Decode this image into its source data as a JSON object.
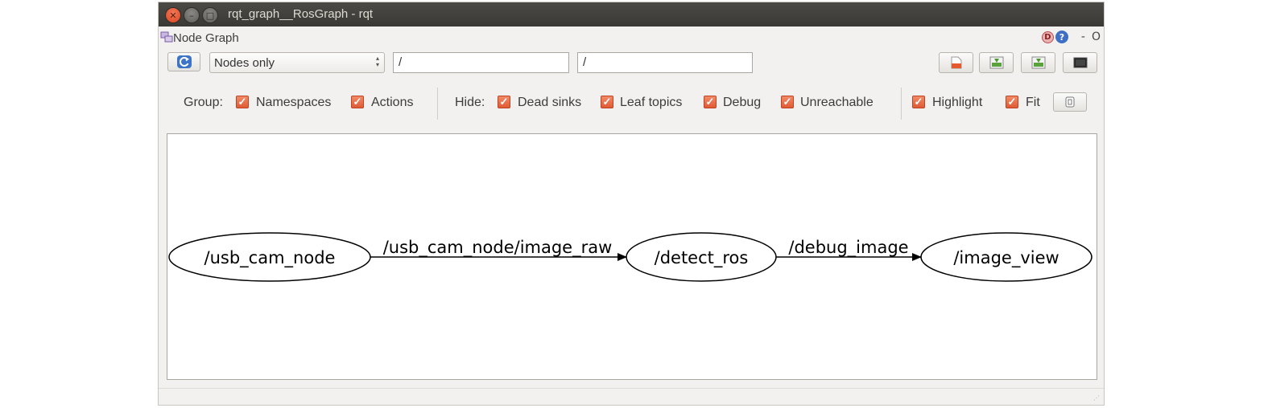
{
  "window": {
    "title": "rqt_graph__RosGraph - rqt"
  },
  "panel": {
    "title": "Node Graph",
    "d_badge": "D",
    "help_badge": "?",
    "minimize_label": "-",
    "close_label": "O"
  },
  "toolbar": {
    "mode_select": "Nodes only",
    "filter_include": "/",
    "filter_exclude": "/"
  },
  "options": {
    "group_label": "Group:",
    "namespaces_label": "Namespaces",
    "actions_label": "Actions",
    "hide_label": "Hide:",
    "dead_sinks_label": "Dead sinks",
    "leaf_topics_label": "Leaf topics",
    "debug_label": "Debug",
    "unreachable_label": "Unreachable",
    "highlight_label": "Highlight",
    "fit_label": "Fit"
  },
  "graph": {
    "nodes": [
      "/usb_cam_node",
      "/detect_ros",
      "/image_view"
    ],
    "edges": [
      {
        "from": "/usb_cam_node",
        "to": "/detect_ros",
        "label": "/usb_cam_node/image_raw"
      },
      {
        "from": "/detect_ros",
        "to": "/image_view",
        "label": "/debug_image"
      }
    ]
  },
  "colors": {
    "checkbox": "#de5b35",
    "titlebar": "#3c3b37",
    "window_bg": "#f2f1f0"
  }
}
